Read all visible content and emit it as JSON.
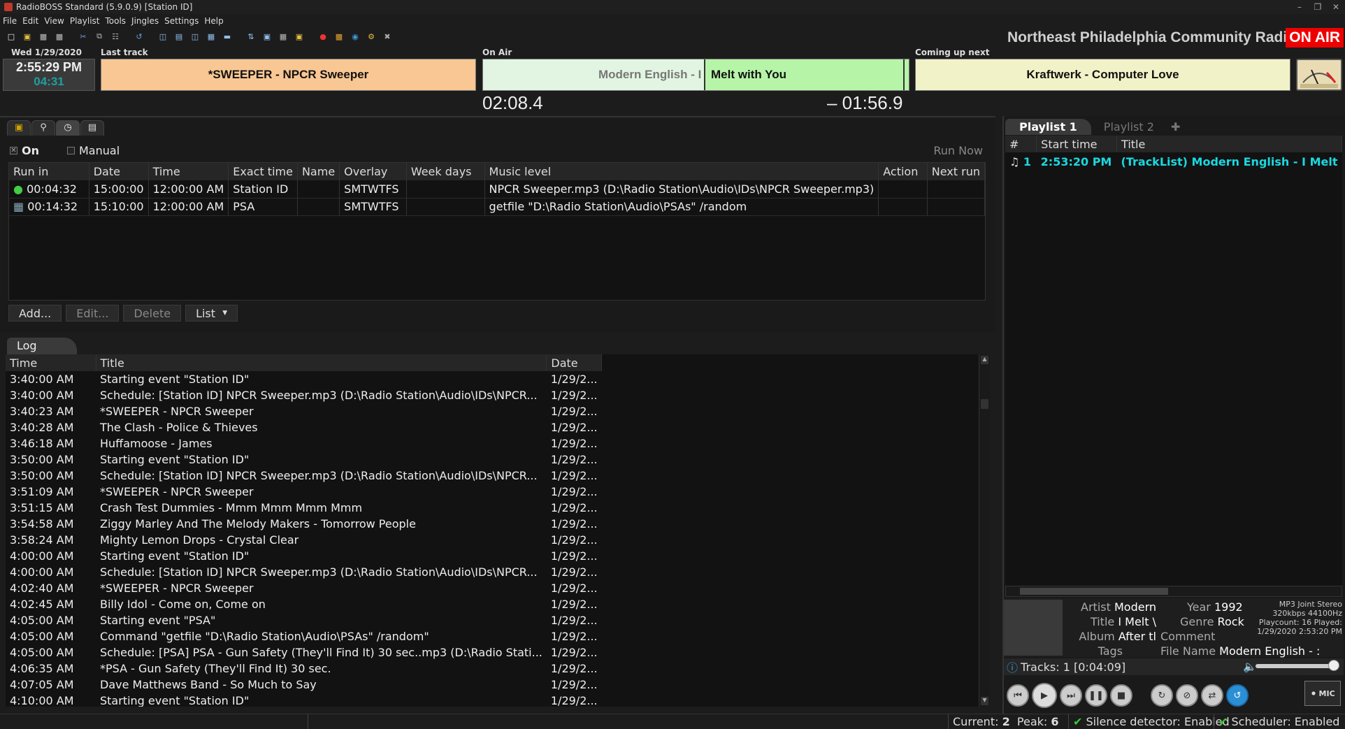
{
  "window": {
    "title": "RadioBOSS Standard (5.9.0.9) [Station ID]"
  },
  "menu": [
    "File",
    "Edit",
    "View",
    "Playlist",
    "Tools",
    "Jingles",
    "Settings",
    "Help"
  ],
  "header": {
    "station_name": "Northeast Philadelphia Community Radio",
    "on_air_badge": "ON AIR",
    "date": "Wed 1/29/2020",
    "time": "2:55:29 PM",
    "countdown": "04:31",
    "last_track_label": "Last track",
    "last_track": "*SWEEPER - NPCR Sweeper",
    "on_air_label": "On Air",
    "on_air_artist": "Modern English - I",
    "on_air_title": "Melt with You",
    "elapsed": "02:08.4",
    "remaining": "– 01:56.9",
    "next_label": "Coming up next",
    "next_track": "Kraftwerk - Computer Love"
  },
  "scheduler": {
    "on_label": "On",
    "manual_label": "Manual",
    "run_now": "Run Now",
    "columns": [
      "Run in",
      "Date",
      "Time",
      "Exact time",
      "Name",
      "Overlay",
      "Week days",
      "Music level",
      "Action",
      "Next run"
    ],
    "rows": [
      {
        "run_in": "00:04:32",
        "date": "15:00:00",
        "time": "12:00:00 AM",
        "exact": "Station ID",
        "name": "",
        "overlay": "SMTWTFS",
        "weekdays": "",
        "music": "NPCR Sweeper.mp3 (D:\\Radio Station\\Audio\\IDs\\NPCR Sweeper.mp3)",
        "action": "",
        "next": ""
      },
      {
        "run_in": "00:14:32",
        "date": "15:10:00",
        "time": "12:00:00 AM",
        "exact": "PSA",
        "name": "",
        "overlay": "SMTWTFS",
        "weekdays": "",
        "music": "getfile \"D:\\Radio Station\\Audio\\PSAs\" /random",
        "action": "",
        "next": ""
      }
    ],
    "buttons": {
      "add": "Add...",
      "edit": "Edit...",
      "delete": "Delete",
      "list": "List"
    }
  },
  "log": {
    "tab": "Log",
    "columns": [
      "Time",
      "Title",
      "Date"
    ],
    "rows": [
      {
        "time": "3:40:00 AM",
        "title": "Starting event \"Station ID\"",
        "date": "1/29/2..."
      },
      {
        "time": "3:40:00 AM",
        "title": "Schedule: [Station ID] NPCR Sweeper.mp3 (D:\\Radio Station\\Audio\\IDs\\NPCR...",
        "date": "1/29/2..."
      },
      {
        "time": "3:40:23 AM",
        "title": "*SWEEPER - NPCR Sweeper",
        "date": "1/29/2..."
      },
      {
        "time": "3:40:28 AM",
        "title": "The Clash - Police & Thieves",
        "date": "1/29/2..."
      },
      {
        "time": "3:46:18 AM",
        "title": "Huffamoose - James",
        "date": "1/29/2..."
      },
      {
        "time": "3:50:00 AM",
        "title": "Starting event \"Station ID\"",
        "date": "1/29/2..."
      },
      {
        "time": "3:50:00 AM",
        "title": "Schedule: [Station ID] NPCR Sweeper.mp3 (D:\\Radio Station\\Audio\\IDs\\NPCR...",
        "date": "1/29/2..."
      },
      {
        "time": "3:51:09 AM",
        "title": "*SWEEPER - NPCR Sweeper",
        "date": "1/29/2..."
      },
      {
        "time": "3:51:15 AM",
        "title": "Crash Test Dummies - Mmm Mmm Mmm Mmm",
        "date": "1/29/2..."
      },
      {
        "time": "3:54:58 AM",
        "title": "Ziggy Marley And The Melody Makers - Tomorrow People",
        "date": "1/29/2..."
      },
      {
        "time": "3:58:24 AM",
        "title": "Mighty Lemon Drops - Crystal Clear",
        "date": "1/29/2..."
      },
      {
        "time": "4:00:00 AM",
        "title": "Starting event \"Station ID\"",
        "date": "1/29/2..."
      },
      {
        "time": "4:00:00 AM",
        "title": "Schedule: [Station ID] NPCR Sweeper.mp3 (D:\\Radio Station\\Audio\\IDs\\NPCR...",
        "date": "1/29/2..."
      },
      {
        "time": "4:02:40 AM",
        "title": "*SWEEPER - NPCR Sweeper",
        "date": "1/29/2..."
      },
      {
        "time": "4:02:45 AM",
        "title": "Billy Idol - Come on, Come on",
        "date": "1/29/2..."
      },
      {
        "time": "4:05:00 AM",
        "title": "Starting event \"PSA\"",
        "date": "1/29/2..."
      },
      {
        "time": "4:05:00 AM",
        "title": "Command \"getfile \"D:\\Radio Station\\Audio\\PSAs\" /random\"",
        "date": "1/29/2..."
      },
      {
        "time": "4:05:00 AM",
        "title": "Schedule: [PSA] PSA - Gun Safety (They'll Find It) 30 sec..mp3 (D:\\Radio Stati...",
        "date": "1/29/2..."
      },
      {
        "time": "4:06:35 AM",
        "title": "*PSA - Gun Safety (They'll Find It) 30 sec.",
        "date": "1/29/2..."
      },
      {
        "time": "4:07:05 AM",
        "title": "Dave Matthews Band - So Much to Say",
        "date": "1/29/2..."
      },
      {
        "time": "4:10:00 AM",
        "title": "Starting event \"Station ID\"",
        "date": "1/29/2..."
      }
    ]
  },
  "playlist": {
    "tabs": [
      "Playlist 1",
      "Playlist 2"
    ],
    "columns": [
      "#",
      "Start time",
      "Title"
    ],
    "rows": [
      {
        "num": "1",
        "start": "2:53:20 PM",
        "title": "(TrackList) Modern English - I Melt"
      }
    ],
    "info": {
      "artist_label": "Artist",
      "artist": "Modern",
      "title_label": "Title",
      "title": "I Melt \\",
      "album_label": "Album",
      "album": "After tl",
      "tags_label": "Tags",
      "year_label": "Year",
      "year": "1992",
      "genre_label": "Genre",
      "genre": "Rock",
      "comment_label": "Comment",
      "filename_label": "File Name",
      "filename": "Modern English - :",
      "tech1": "MP3 Joint Stereo",
      "tech2": "320kbps 44100Hz",
      "tech3": "Playcount: 16  Played:",
      "tech4": "1/29/2020 2:53:20 PM"
    },
    "tracks": "Tracks: 1 [0:04:09]",
    "mic": "MIC"
  },
  "status": {
    "current_label": "Current:",
    "current": "2",
    "peak_label": "Peak:",
    "peak": "6",
    "silence": "Silence detector: Enabled",
    "scheduler": "Scheduler: Enabled"
  },
  "colors": {
    "last_track_bg": "#f9c793",
    "on_air_bg": "#b6f5a8",
    "next_bg": "#f2f2c8",
    "on_air_badge": "#e00000",
    "playlist_text": "#1ad8e0"
  }
}
